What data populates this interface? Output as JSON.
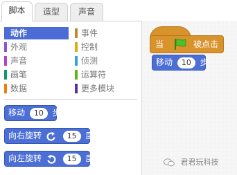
{
  "tabs": [
    {
      "label": "脚本",
      "active": true
    },
    {
      "label": "造型",
      "active": false
    },
    {
      "label": "声音",
      "active": false
    }
  ],
  "categories": [
    {
      "label": "动作",
      "color": "#4a6cd4",
      "selected": true
    },
    {
      "label": "外观",
      "color": "#8a55d7",
      "selected": false
    },
    {
      "label": "声音",
      "color": "#bb42c3",
      "selected": false
    },
    {
      "label": "画笔",
      "color": "#0e9a6c",
      "selected": false
    },
    {
      "label": "数据",
      "color": "#ee7d16",
      "selected": false
    },
    {
      "label": "事件",
      "color": "#c88330",
      "selected": false
    },
    {
      "label": "控制",
      "color": "#e1a91a",
      "selected": false
    },
    {
      "label": "侦测",
      "color": "#2ca5e2",
      "selected": false
    },
    {
      "label": "运算符",
      "color": "#5cb712",
      "selected": false
    },
    {
      "label": "更多模块",
      "color": "#632d99",
      "selected": false
    }
  ],
  "palette_blocks": {
    "move": {
      "label": "移动",
      "value": "10",
      "unit": "步"
    },
    "turn_right": {
      "label": "向右旋转",
      "icon": "rotate-clockwise-icon",
      "value": "15",
      "unit": "度"
    },
    "turn_left": {
      "label": "向左旋转",
      "icon": "rotate-counterclockwise-icon",
      "value": "15",
      "unit": "度"
    }
  },
  "script": {
    "hat": {
      "prefix": "当",
      "icon": "green-flag-icon",
      "suffix": "被点击"
    },
    "move": {
      "label": "移动",
      "value": "10",
      "unit": "步"
    }
  },
  "watermark": {
    "text": "君君玩科技",
    "icon": "wechat-icon"
  },
  "colors": {
    "motion": "#4c6fd6",
    "events": "#d8932d"
  }
}
